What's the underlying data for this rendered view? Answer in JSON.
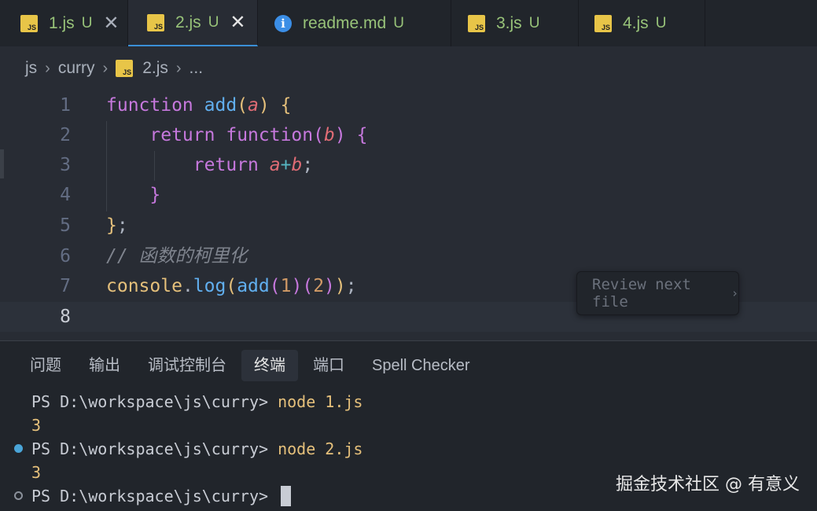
{
  "tabs": [
    {
      "name": "1.js",
      "status": "U",
      "icon": "js-file-icon",
      "active": false,
      "close": "✕"
    },
    {
      "name": "2.js",
      "status": "U",
      "icon": "js-file-icon",
      "active": true,
      "close": "✕"
    },
    {
      "name": "readme.md",
      "status": "U",
      "icon": "info-icon",
      "active": false
    },
    {
      "name": "3.js",
      "status": "U",
      "icon": "js-file-icon",
      "active": false
    },
    {
      "name": "4.js",
      "status": "U",
      "icon": "js-file-icon",
      "active": false
    }
  ],
  "js_badge": "JS",
  "info_glyph": "i",
  "breadcrumb": [
    "js",
    "curry",
    "2.js",
    "..."
  ],
  "editor": {
    "line_numbers": [
      "1",
      "2",
      "3",
      "4",
      "5",
      "6",
      "7",
      "8"
    ],
    "current_line": "8",
    "code": {
      "l1": {
        "kw": "function",
        "name": "add",
        "open": "(",
        "param": "a",
        "close": ")",
        "brace": "{"
      },
      "l2": {
        "kw": "return",
        "kw2": "function",
        "open": "(",
        "param": "b",
        "close": ")",
        "brace": "{"
      },
      "l3": {
        "kw": "return",
        "a": "a",
        "op": "+",
        "b": "b",
        "semi": ";"
      },
      "l4": {
        "brace": "}"
      },
      "l5": {
        "brace": "}",
        "semi": ";"
      },
      "l6": {
        "comment": "// 函数的柯里化"
      },
      "l7": {
        "obj": "console",
        "dot": ".",
        "method": "log",
        "p1": "(",
        "fn": "add",
        "p2": "(",
        "n1": "1",
        "p3": ")",
        "p4": "(",
        "n2": "2",
        "p5": ")",
        "p6": ")",
        "semi": ";"
      }
    }
  },
  "review_button": {
    "label": "Review next file",
    "chevron": "›"
  },
  "panel": {
    "tabs": [
      "问题",
      "输出",
      "调试控制台",
      "终端",
      "端口",
      "Spell Checker"
    ],
    "active_tab": "终端"
  },
  "terminal": [
    {
      "prompt": "PS D:\\workspace\\js\\curry> ",
      "cmd": "node 1.js"
    },
    {
      "output": "3"
    },
    {
      "prompt": "PS D:\\workspace\\js\\curry> ",
      "cmd": "node 2.js"
    },
    {
      "output": "3"
    },
    {
      "prompt": "PS D:\\workspace\\js\\curry> ",
      "cmd": ""
    }
  ],
  "watermark": "掘金技术社区 @ 有意义",
  "colors": {
    "accent": "#3a8fd6",
    "untracked": "#98c379",
    "keyword": "#c678dd",
    "function": "#61afef",
    "param": "#e06c75"
  }
}
